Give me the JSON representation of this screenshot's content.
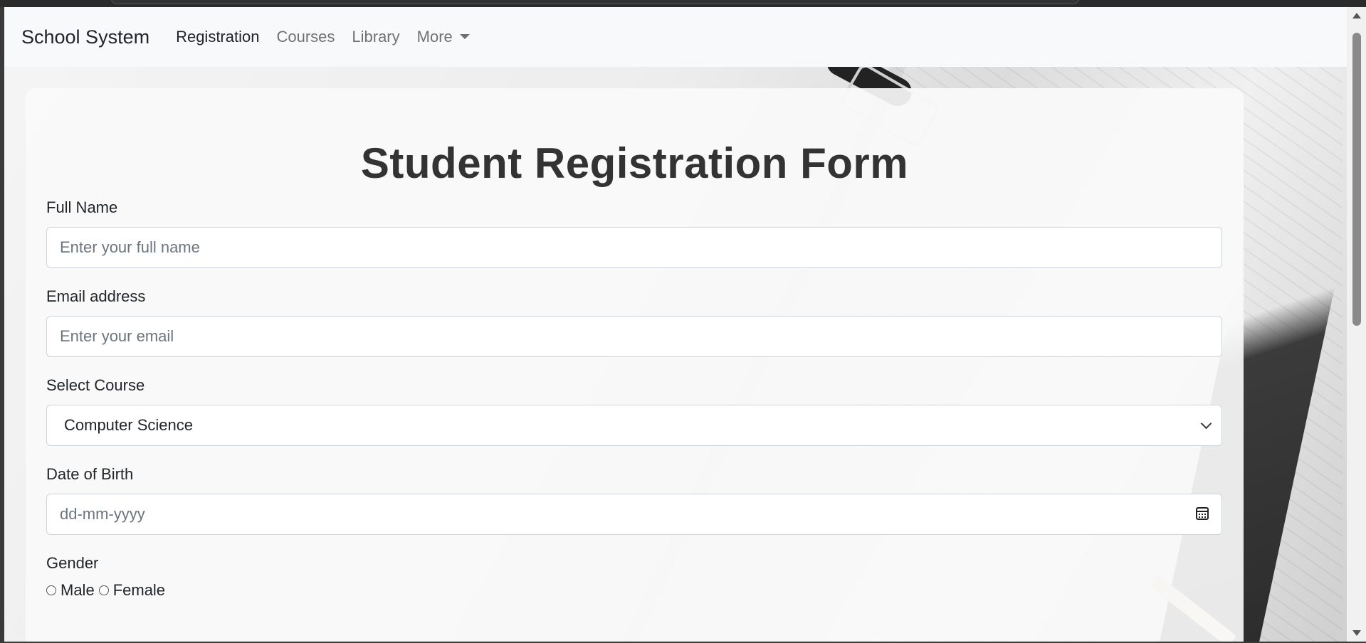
{
  "navbar": {
    "brand": "School System",
    "links": [
      {
        "label": "Registration",
        "active": true
      },
      {
        "label": "Courses",
        "active": false
      },
      {
        "label": "Library",
        "active": false
      },
      {
        "label": "More",
        "active": false,
        "dropdown": true
      }
    ]
  },
  "form": {
    "title": "Student Registration Form",
    "full_name": {
      "label": "Full Name",
      "placeholder": "Enter your full name"
    },
    "email": {
      "label": "Email address",
      "placeholder": "Enter your email"
    },
    "course": {
      "label": "Select Course",
      "selected": "Computer Science"
    },
    "dob": {
      "label": "Date of Birth",
      "placeholder": "dd-mm-yyyy"
    },
    "gender": {
      "label": "Gender",
      "options": [
        "Male",
        "Female"
      ]
    }
  },
  "icons": {
    "course_dropdown": "chevron-down-icon",
    "dob_picker": "calendar-icon",
    "more_dropdown": "caret-down-icon"
  },
  "colors": {
    "primary": "#0d6efd",
    "navbar_bg": "#f8f9fa"
  }
}
